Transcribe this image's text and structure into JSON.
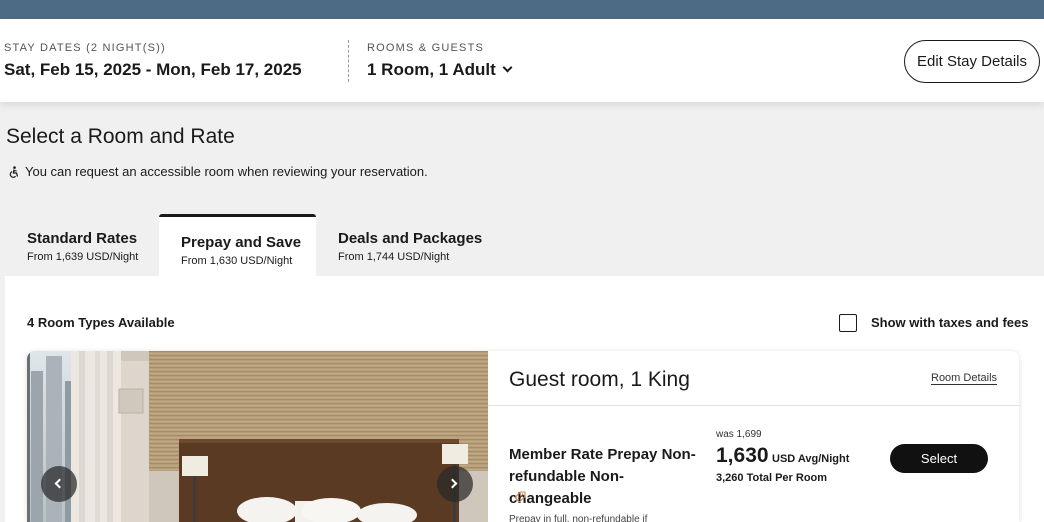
{
  "stay": {
    "dates_label": "STAY DATES (2 NIGHT(S))",
    "dates_value": "Sat, Feb 15, 2025 - Mon, Feb 17, 2025",
    "rooms_label": "ROOMS & GUESTS",
    "rooms_value": "1 Room, 1 Adult",
    "edit_label": "Edit Stay Details"
  },
  "page": {
    "title": "Select a Room and Rate",
    "accessible_note": "You can request an accessible room when reviewing your reservation."
  },
  "tabs": [
    {
      "label": "Standard Rates",
      "sub": "From 1,639 USD/Night",
      "active": false
    },
    {
      "label": "Prepay and Save",
      "sub": "From 1,630 USD/Night",
      "active": true
    },
    {
      "label": "Deals and Packages",
      "sub": "From 1,744 USD/Night",
      "active": false
    }
  ],
  "results": {
    "count_label": "4 Room Types Available",
    "taxes_label": "Show with taxes and fees",
    "taxes_checked": false
  },
  "room": {
    "name": "Guest room, 1 King",
    "details_link": "Room Details",
    "rate": {
      "name": "Member Rate Prepay Non-refundable Non-changeable",
      "note": "Prepay in full, non-refundable if",
      "was": "was 1,699",
      "price": "1,630",
      "unit": "USD Avg/Night",
      "total": "3,260 Total Per Room",
      "select_label": "Select"
    }
  },
  "colors": {
    "topbar": "#4e6b85",
    "accent_dark": "#111111",
    "tag_icon": "#d9824b"
  },
  "icons": [
    "accessibility-icon",
    "chevron-down-icon",
    "chevron-left-icon",
    "chevron-right-icon",
    "tag-icon",
    "checkbox-icon"
  ]
}
